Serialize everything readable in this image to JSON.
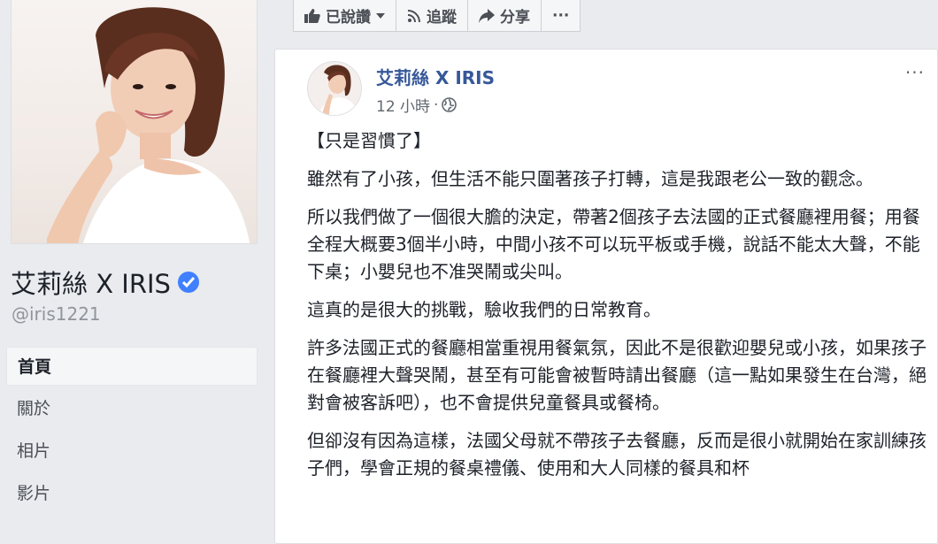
{
  "page": {
    "name": "艾莉絲 X IRIS",
    "handle": "@iris1221",
    "verified_icon": "verified-check-icon"
  },
  "nav": {
    "items": [
      {
        "label": "首頁",
        "active": true
      },
      {
        "label": "關於",
        "active": false
      },
      {
        "label": "相片",
        "active": false
      },
      {
        "label": "影片",
        "active": false
      }
    ]
  },
  "action_bar": {
    "liked_label": "已說讚",
    "follow_label": "追蹤",
    "share_label": "分享",
    "more_label": "···"
  },
  "post": {
    "author": "艾莉絲 X IRIS",
    "time": "12 小時",
    "dot": "·",
    "options": "···",
    "paragraphs": [
      "【只是習慣了】",
      "雖然有了小孩，但生活不能只圍著孩子打轉，這是我跟老公一致的觀念。",
      "所以我們做了一個很大膽的決定，帶著2個孩子去法國的正式餐廳裡用餐；用餐全程大概要3個半小時，中間小孩不可以玩平板或手機，說話不能太大聲，不能下桌；小嬰兒也不准哭鬧或尖叫。",
      "這真的是很大的挑戰，驗收我們的日常教育。",
      "許多法國正式的餐廳相當重視用餐氣氛，因此不是很歡迎嬰兒或小孩，如果孩子在餐廳裡大聲哭鬧，甚至有可能會被暫時請出餐廳（這一點如果發生在台灣，絕對會被客訴吧），也不會提供兒童餐具或餐椅。",
      "但卻沒有因為這樣，法國父母就不帶孩子去餐廳，反而是很小就開始在家訓練孩子們，學會正規的餐桌禮儀、使用和大人同樣的餐具和杯"
    ]
  },
  "colors": {
    "background": "#e9ebee",
    "link": "#365899",
    "verified": "#4080ff"
  }
}
